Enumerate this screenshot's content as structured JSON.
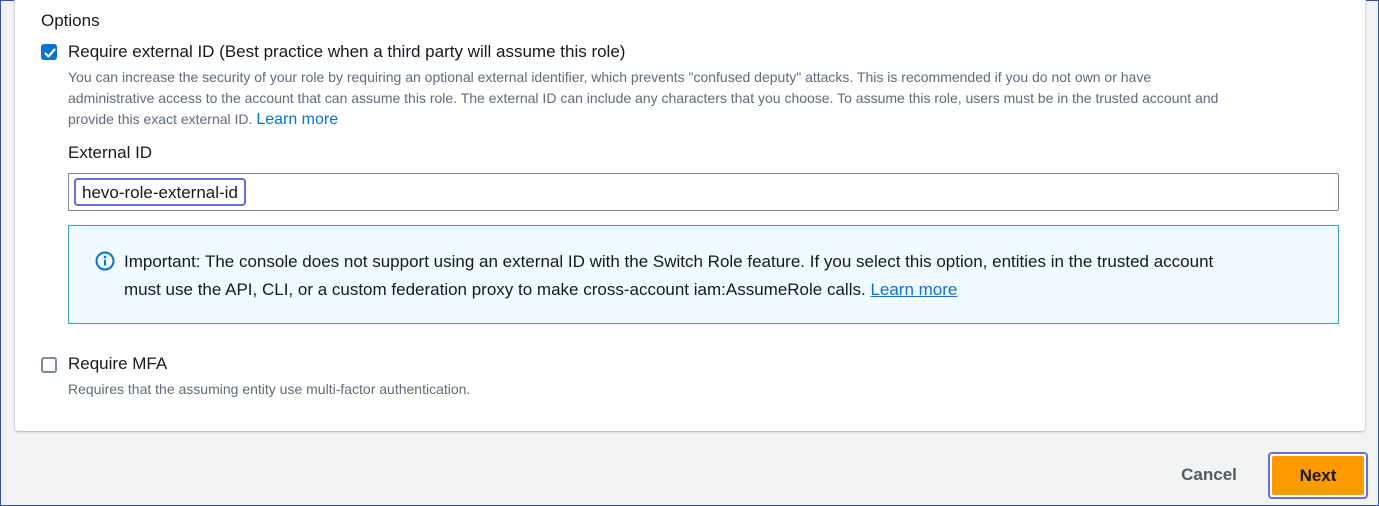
{
  "options": {
    "title": "Options",
    "require_external_id": {
      "checked": true,
      "label": "Require external ID (Best practice when a third party will assume this role)",
      "description_line1": "You can increase the security of your role by requiring an optional external identifier, which prevents \"confused deputy\" attacks. This is recommended if you do not own or have",
      "description_line2": "administrative access to the account that can assume this role. The external ID can include any characters that you choose. To assume this role, users must be in the trusted account and",
      "description_line3": "provide this exact external ID.",
      "learn_more": "Learn more"
    },
    "external_id": {
      "label": "External ID",
      "value": "hevo-role-external-id"
    },
    "alert": {
      "icon": "info-circle-icon",
      "text_line1": "Important: The console does not support using an external ID with the Switch Role feature. If you select this option, entities in the trusted account",
      "text_line2": "must use the API, CLI, or a custom federation proxy to make cross-account iam:AssumeRole calls.",
      "learn_more": "Learn more"
    },
    "require_mfa": {
      "checked": false,
      "label": "Require MFA",
      "description": "Requires that the assuming entity use multi-factor authentication."
    }
  },
  "footer": {
    "cancel_label": "Cancel",
    "next_label": "Next"
  },
  "colors": {
    "accent": "#0972d3",
    "primary_button": "#ff9900",
    "focus_ring": "#6b6bdc",
    "alert_background": "#f1faff"
  }
}
